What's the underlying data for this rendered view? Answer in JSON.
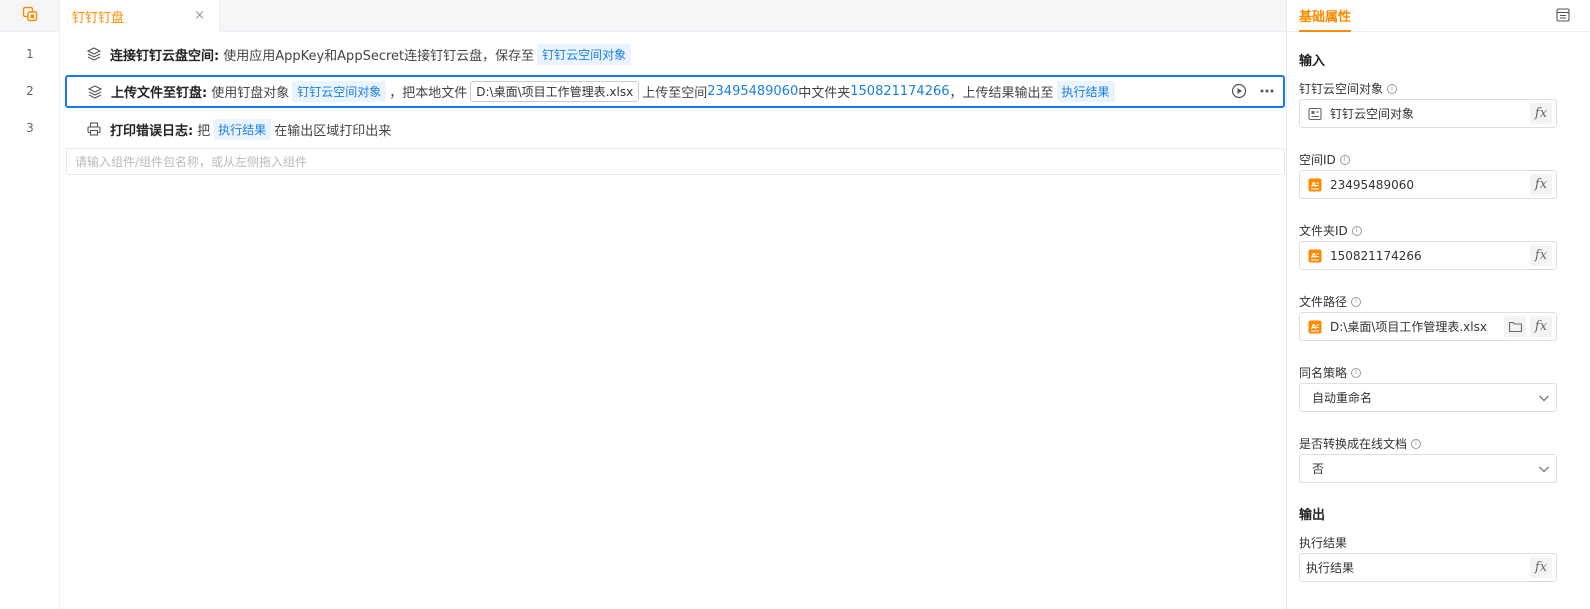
{
  "tab": {
    "label": "钉钉钉盘",
    "close": "×"
  },
  "lines": [
    "1",
    "2",
    "3"
  ],
  "rows": [
    {
      "title": "连接钉钉云盘空间:",
      "text1": "使用应用AppKey和AppSecret连接钉钉云盘，保存至",
      "tag1": "钉钉云空间对象"
    },
    {
      "title": "上传文件至钉盘:",
      "text1": "使用钉盘对象",
      "tag1": "钉钉云空间对象",
      "text2": "，把本地文件",
      "path": "D:\\桌面\\项目工作管理表.xlsx",
      "text3": "上传至空间",
      "space_id": "23495489060",
      "text4": "中文件夹",
      "folder_id": "150821174266",
      "text5": "，上传结果输出至",
      "tag2": "执行结果"
    },
    {
      "title": "打印错误日志:",
      "text1": "把",
      "tag1": "执行结果",
      "text2": "在输出区域打印出来"
    }
  ],
  "add_input": {
    "placeholder": "请输入组件/组件包名称，或从左侧拖入组件"
  },
  "panel": {
    "tab": "基础属性",
    "input_section": "输入",
    "fields": [
      {
        "label": "钉钉云空间对象",
        "value": "钉钉云空间对象"
      },
      {
        "label": "空间ID",
        "value": "23495489060"
      },
      {
        "label": "文件夹ID",
        "value": "150821174266"
      },
      {
        "label": "文件路径",
        "value": "D:\\桌面\\项目工作管理表.xlsx"
      }
    ],
    "strategy": {
      "label": "同名策略",
      "value": "自动重命名"
    },
    "convert": {
      "label": "是否转换成在线文档",
      "value": "否"
    },
    "output_section": "输出",
    "output": {
      "label": "执行结果",
      "value": "执行结果"
    },
    "fx": "fx",
    "info": "i"
  },
  "colors": {
    "accent": "#ff8a00",
    "link": "#1a7fe0",
    "selected": "#1677ff"
  }
}
